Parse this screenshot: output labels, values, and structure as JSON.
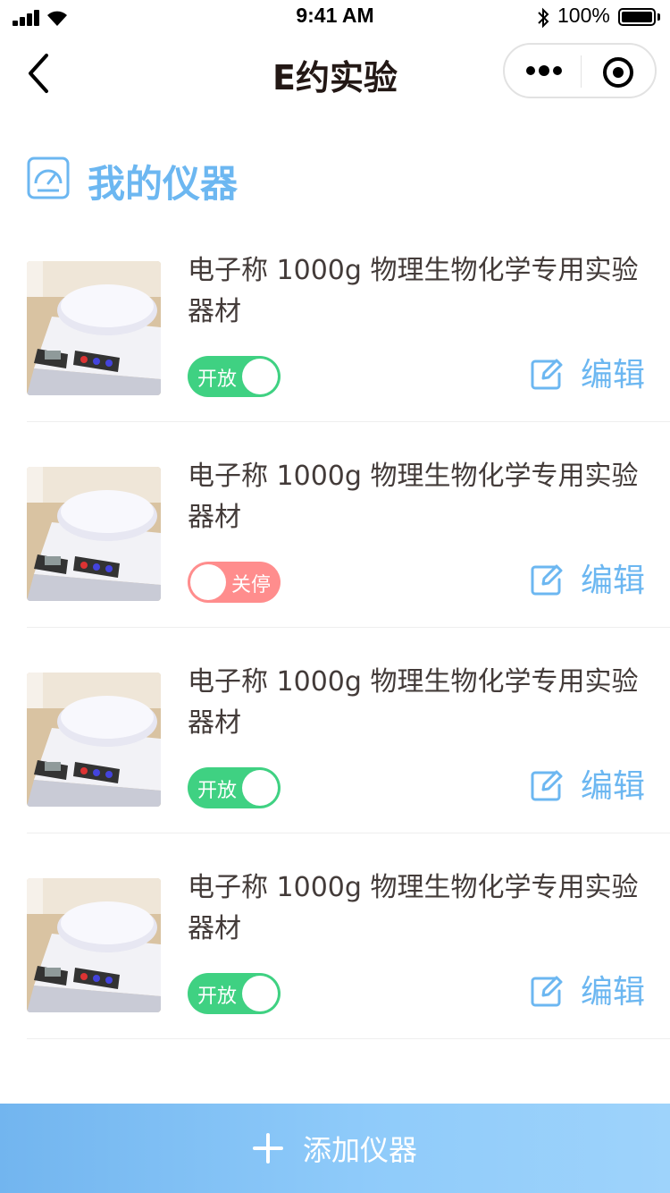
{
  "status_bar": {
    "time": "9:41 AM",
    "battery": "100%"
  },
  "nav": {
    "title": "E约实验"
  },
  "section": {
    "title": "我的仪器"
  },
  "instruments": [
    {
      "name": "电子称 1000g 物理生物化学专用实验器材",
      "status": "on",
      "toggle_label": "开放",
      "edit_label": "编辑"
    },
    {
      "name": "电子称 1000g 物理生物化学专用实验器材",
      "status": "off",
      "toggle_label": "关停",
      "edit_label": "编辑"
    },
    {
      "name": "电子称 1000g 物理生物化学专用实验器材",
      "status": "on",
      "toggle_label": "开放",
      "edit_label": "编辑"
    },
    {
      "name": "电子称 1000g 物理生物化学专用实验器材",
      "status": "on",
      "toggle_label": "开放",
      "edit_label": "编辑"
    }
  ],
  "footer": {
    "add_label": "添加仪器"
  },
  "colors": {
    "title": "#231815",
    "text": "#433b39",
    "accent": "#6cb7f1",
    "divider": "#eeeeee",
    "button": "#8fcbfa",
    "on": "#3fd182",
    "off": "#ff8d8d"
  },
  "icons": [
    "signal-icon",
    "wifi-icon",
    "bluetooth-icon",
    "battery-icon",
    "back-arrow-icon",
    "more-dots-icon",
    "target-icon",
    "gauge-icon",
    "edit-icon",
    "plus-icon"
  ]
}
